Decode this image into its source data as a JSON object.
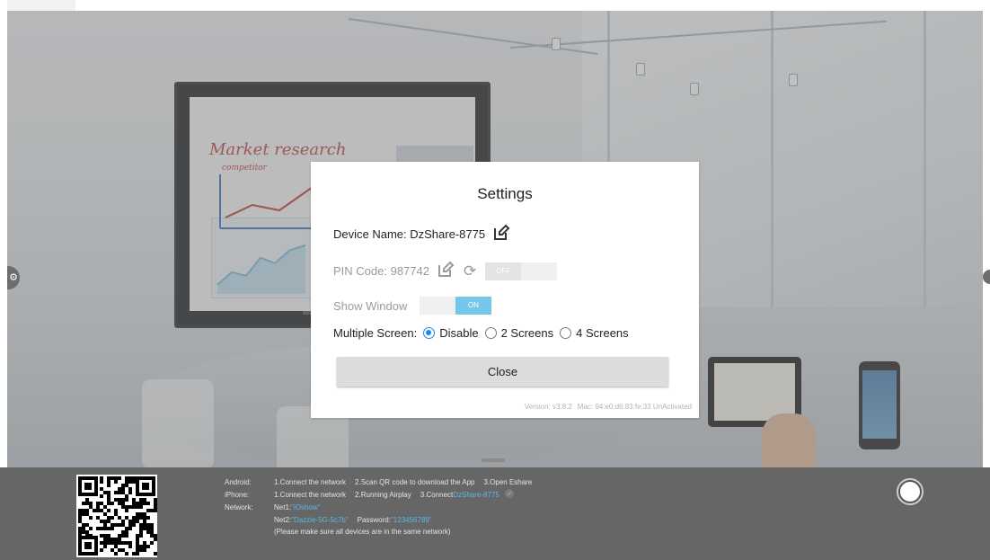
{
  "dialog": {
    "title": "Settings",
    "device_name_label": "Device Name: DzShare-8775",
    "pin_code_label": "PIN Code: 987742",
    "pin_toggle": "OFF",
    "show_window_label": "Show Window",
    "show_window_toggle": "ON",
    "multiple_screen_label": "Multiple Screen:",
    "options": [
      {
        "label": "Disable",
        "checked": true
      },
      {
        "label": "2 Screens",
        "checked": false
      },
      {
        "label": "4 Screens",
        "checked": false
      }
    ],
    "close_button": "Close",
    "version": "Version: v3.8.2",
    "mac": "Mac: 94:e0:d6:83:fe:33 UnActivated"
  },
  "bottom": {
    "android_key": "Android:",
    "android_steps": [
      "1.Connect the network",
      "2.Scan QR code to download the App",
      "3.Open Eshare"
    ],
    "iphone_key": "iPhone:",
    "iphone_steps": [
      "1.Connect the network",
      "2.Running Airplay",
      "3.Connect"
    ],
    "iphone_device": "DzShare-8775",
    "network_key": "Network:",
    "net1_label": "Net1:",
    "net1_value": "\"iOshow\"",
    "net2_label": "Net2:",
    "net2_value": "\"Dazzle-5G-5c7b\"",
    "password_label": "Password:",
    "password_value": "\"123456789\"",
    "note": "(Please make sure all devices are in the same network)"
  },
  "background": {
    "board_text": "Market research",
    "board_sub": "competitor"
  },
  "colors": {
    "accent": "#1e88e5",
    "toggle_on": "#75c7ea",
    "link": "#58b8e8",
    "bar": "#666666"
  }
}
